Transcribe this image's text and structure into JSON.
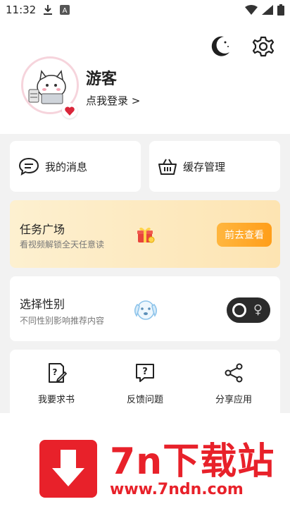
{
  "status_bar": {
    "time": "11:32"
  },
  "header": {
    "username": "游客",
    "login_link": "点我登录 >"
  },
  "quick_cards": {
    "messages_label": "我的消息",
    "cache_label": "缓存管理"
  },
  "task": {
    "title": "任务广场",
    "subtitle": "看视频解锁全天任意读",
    "button": "前去查看"
  },
  "gender": {
    "title": "选择性别",
    "subtitle": "不同性别影响推荐内容",
    "toggle_symbol": "♀"
  },
  "tools": [
    {
      "label": "我要求书",
      "icon": "request-book-icon"
    },
    {
      "label": "反馈问题",
      "icon": "feedback-icon"
    },
    {
      "label": "分享应用",
      "icon": "share-icon"
    }
  ],
  "watermark": {
    "title": "7n下载站",
    "url": "www.7ndn.com",
    "color": "#e8212a"
  },
  "colors": {
    "accent": "#ff9e1a",
    "toggle": "#2b2b2b",
    "heart": "#d9263a"
  }
}
